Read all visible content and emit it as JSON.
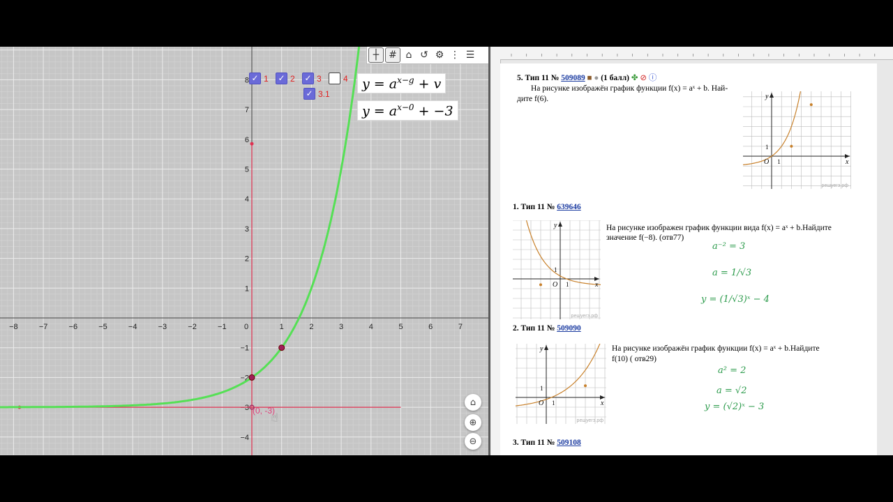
{
  "geogebra": {
    "toolbar_icons": [
      "move-graphics-icon",
      "grid-icon",
      "home-icon",
      "undo-redo-icon",
      "gear-icon",
      "more-icon",
      "menu-icon"
    ],
    "x_ticks": [
      "−8",
      "−7",
      "−6",
      "−5",
      "−4",
      "−3",
      "−2",
      "−1",
      "0",
      "1",
      "2",
      "3",
      "4",
      "5",
      "6",
      "7"
    ],
    "y_ticks": [
      "8",
      "7",
      "6",
      "5",
      "4",
      "3",
      "2",
      "1",
      "−1",
      "−2",
      "−3",
      "−4"
    ],
    "checkboxes": [
      {
        "label": "1",
        "checked": true
      },
      {
        "label": "2",
        "checked": true
      },
      {
        "label": "3",
        "checked": true
      },
      {
        "label": "4",
        "checked": false
      },
      {
        "label": "3.1",
        "checked": true
      }
    ],
    "formula1": {
      "base": "y = a",
      "exp": "x−g",
      "tail": " + v"
    },
    "formula2": {
      "base": "y = a",
      "exp": "x−0",
      "tail": " + −3"
    },
    "point_label": "(0, -3)",
    "curve_color": "#55e055",
    "line_color": "#e03050"
  },
  "document": {
    "p5": {
      "head": "5. Тип 11 № ",
      "num": "509089",
      "score": " (1 балл)",
      "text1": "На рисунке изображён график функции f(x) = aˣ + b. Най-",
      "text2": "дите f(6)."
    },
    "p1": {
      "head": "1. Тип 11 № ",
      "num": "639646",
      "text1": "На рисунке изображен график функции вида f(x) = aˣ + b.Найдите",
      "text2": "значение f(−8).  (отв77)",
      "sol1": "a⁻² = 3",
      "sol2a": "a = ",
      "sol2b": "1/√3",
      "sol3": "y = (1/√3)ˣ − 4"
    },
    "p2": {
      "head": "2. Тип 11 № ",
      "num": "509090",
      "text1": "На рисунке изображён график функции f(x) = aˣ + b.Найдите",
      "text2": "f(10)  ( отв29)",
      "sol1": "a² = 2",
      "sol2": "a = √2",
      "sol3": "y = (√2)ˣ − 3"
    },
    "p3": {
      "head": "3. Тип 11 № ",
      "num": "509108"
    },
    "graph_labels": {
      "y": "y",
      "x": "x",
      "o": "O",
      "one": "1",
      "wm": "решуегэ.рф"
    }
  }
}
